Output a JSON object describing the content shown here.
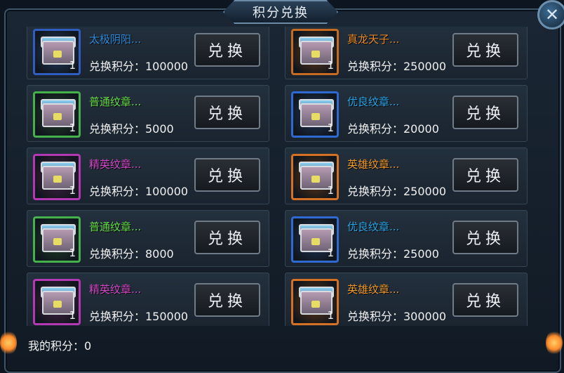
{
  "window": {
    "title": "积分兑换",
    "close_label": "✕"
  },
  "items": [
    {
      "name": "太极阴阳...",
      "cost": "兑换积分：100000",
      "qty": "1",
      "button": "兑换",
      "rarity_color": "#2a8de0",
      "frame_color": "#2f5ec0",
      "bg_color": "#263e67"
    },
    {
      "name": "真龙天子...",
      "cost": "兑换积分：250000",
      "qty": "1",
      "button": "兑换",
      "rarity_color": "#e88c2a",
      "frame_color": "#c66b1f",
      "bg_color": "#6b3a17"
    },
    {
      "name": "普通纹章...",
      "cost": "兑换积分：5000",
      "qty": "1",
      "button": "兑换",
      "rarity_color": "#66e04c",
      "frame_color": "#44b14a",
      "bg_color": "#23422a"
    },
    {
      "name": "优良纹章...",
      "cost": "兑换积分：20000",
      "qty": "1",
      "button": "兑换",
      "rarity_color": "#2aa7e8",
      "frame_color": "#2e6ad1",
      "bg_color": "#22375f"
    },
    {
      "name": "精英纹章...",
      "cost": "兑换积分：100000",
      "qty": "1",
      "button": "兑换",
      "rarity_color": "#d44ac9",
      "frame_color": "#b438b3",
      "bg_color": "#51214c"
    },
    {
      "name": "英雄纹章...",
      "cost": "兑换积分：250000",
      "qty": "1",
      "button": "兑换",
      "rarity_color": "#ef9a2c",
      "frame_color": "#d67022",
      "bg_color": "#6d3b14"
    },
    {
      "name": "普通纹章...",
      "cost": "兑换积分：8000",
      "qty": "1",
      "button": "兑换",
      "rarity_color": "#66e04c",
      "frame_color": "#44b14a",
      "bg_color": "#23422a"
    },
    {
      "name": "优良纹章...",
      "cost": "兑换积分：25000",
      "qty": "1",
      "button": "兑换",
      "rarity_color": "#2aa7e8",
      "frame_color": "#2e6ad1",
      "bg_color": "#22375f"
    },
    {
      "name": "精英纹章...",
      "cost": "兑换积分：150000",
      "qty": "1",
      "button": "兑换",
      "rarity_color": "#d44ac9",
      "frame_color": "#b438b3",
      "bg_color": "#51214c"
    },
    {
      "name": "英雄纹章...",
      "cost": "兑换积分：300000",
      "qty": "1",
      "button": "兑换",
      "rarity_color": "#ef9a2c",
      "frame_color": "#d67022",
      "bg_color": "#6d3b14"
    }
  ],
  "footer": {
    "my_points": "我的积分：0"
  }
}
